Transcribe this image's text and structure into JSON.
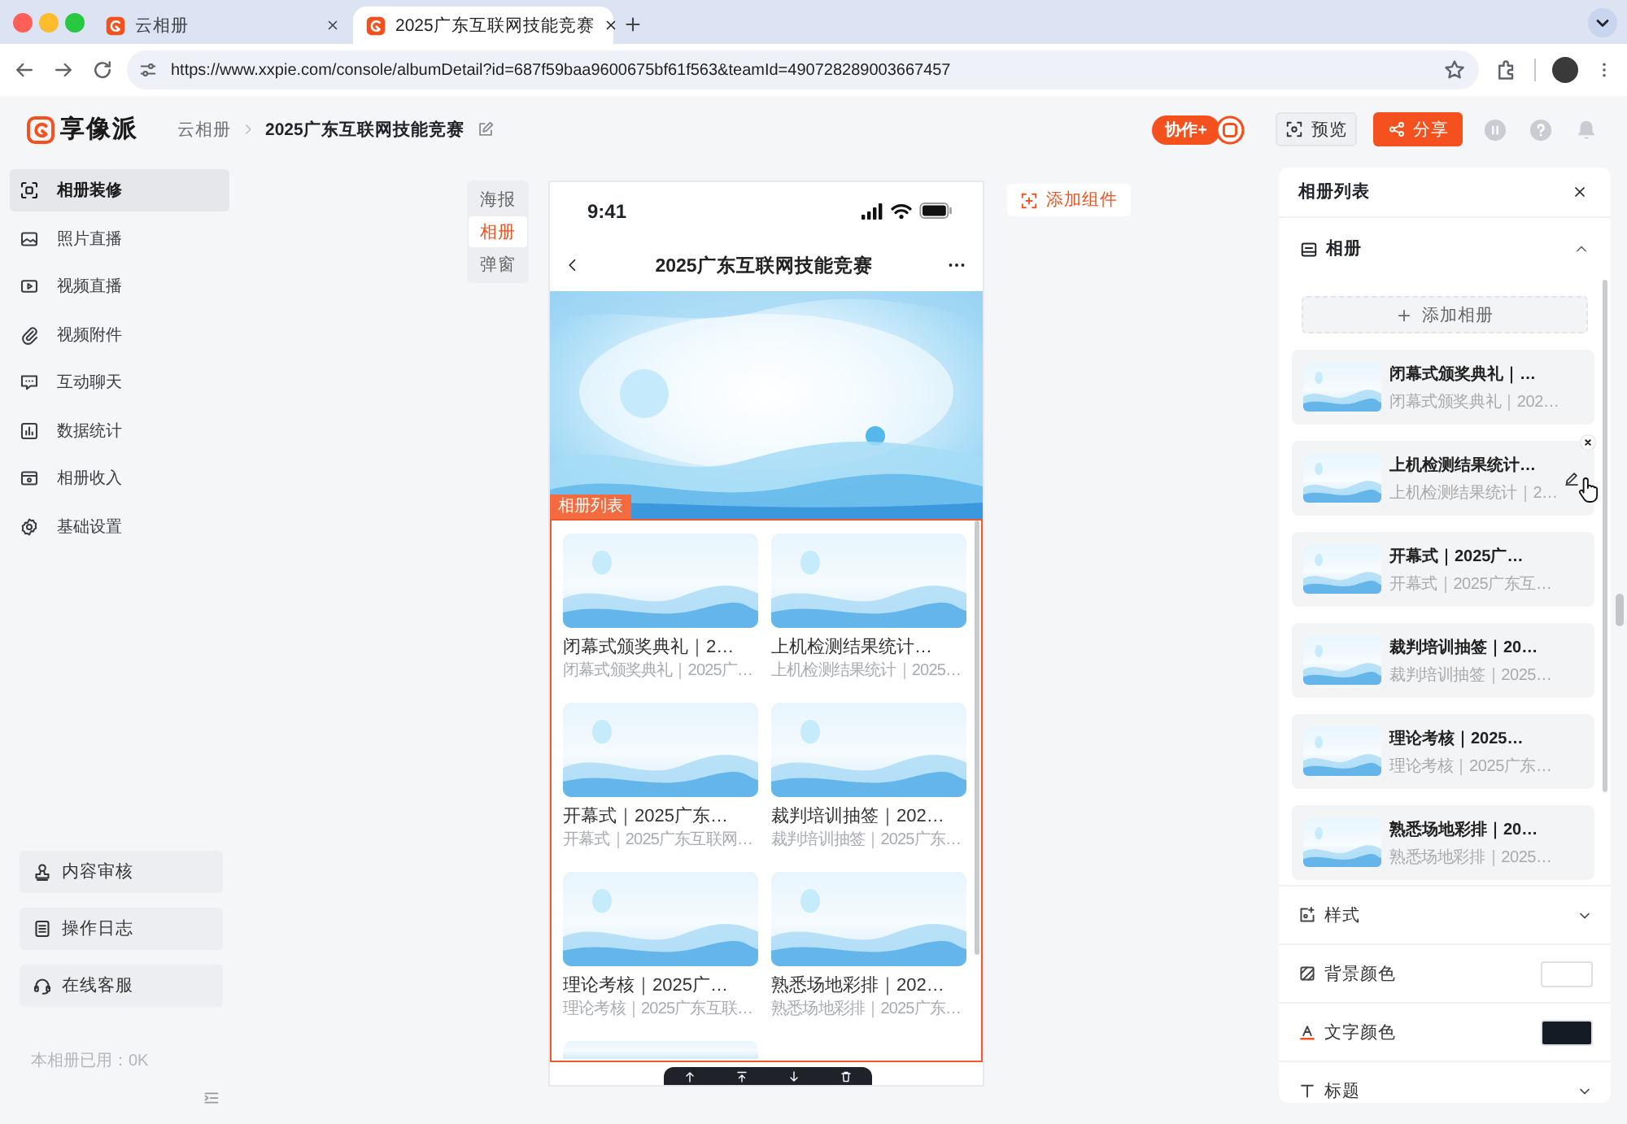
{
  "browser": {
    "tabs": [
      {
        "title": "云相册",
        "selected": false
      },
      {
        "title": "2025广东互联网技能竞赛",
        "selected": true
      }
    ],
    "url": "https://www.xxpie.com/console/albumDetail?id=687f59baa9600675bf61f563&teamId=490728289003667457"
  },
  "header": {
    "logo": "享像派",
    "breadcrumb": [
      "云相册",
      "2025广东互联网技能竞赛"
    ],
    "collab_button": "协作+",
    "preview_button": "预览",
    "share_button": "分享"
  },
  "sidebar": {
    "items": [
      {
        "label": "相册装修",
        "selected": true
      },
      {
        "label": "照片直播",
        "selected": false
      },
      {
        "label": "视频直播",
        "selected": false
      },
      {
        "label": "视频附件",
        "selected": false
      },
      {
        "label": "互动聊天",
        "selected": false
      },
      {
        "label": "数据统计",
        "selected": false
      },
      {
        "label": "相册收入",
        "selected": false
      },
      {
        "label": "基础设置",
        "selected": false
      }
    ],
    "bottom_buttons": [
      "内容审核",
      "操作日志",
      "在线客服"
    ],
    "usage": "本相册已用：0K"
  },
  "editor": {
    "side_tabs": [
      {
        "label": "海报",
        "selected": false
      },
      {
        "label": "相册",
        "selected": true
      },
      {
        "label": "弹窗",
        "selected": false
      }
    ],
    "add_component_button": "添加组件"
  },
  "phone": {
    "time": "9:41",
    "title": "2025广东互联网技能竞赛",
    "component_tag": "相册列表",
    "albums": [
      {
        "title": "闭幕式颁奖典礼｜2…",
        "subtitle": "闭幕式颁奖典礼｜2025广…"
      },
      {
        "title": "上机检测结果统计…",
        "subtitle": "上机检测结果统计｜2025…"
      },
      {
        "title": "开幕式｜2025广东…",
        "subtitle": "开幕式｜2025广东互联网…"
      },
      {
        "title": "裁判培训抽签｜202…",
        "subtitle": "裁判培训抽签｜2025广东…"
      },
      {
        "title": "理论考核｜2025广…",
        "subtitle": "理论考核｜2025广东互联…"
      },
      {
        "title": "熟悉场地彩排｜202…",
        "subtitle": "熟悉场地彩排｜2025广东…"
      }
    ],
    "next_cover_peeking": true
  },
  "panel": {
    "title": "相册列表",
    "section": {
      "label": "相册",
      "expanded": true
    },
    "add_button": "添加相册",
    "albums": [
      {
        "title": "闭幕式颁奖典礼｜…",
        "subtitle": "闭幕式颁奖典礼｜202…",
        "hovered": false
      },
      {
        "title": "上机检测结果统计…",
        "subtitle": "上机检测结果统计｜2…",
        "hovered": true
      },
      {
        "title": "开幕式｜2025广…",
        "subtitle": "开幕式｜2025广东互…",
        "hovered": false
      },
      {
        "title": "裁判培训抽签｜20…",
        "subtitle": "裁判培训抽签｜2025…",
        "hovered": false
      },
      {
        "title": "理论考核｜2025…",
        "subtitle": "理论考核｜2025广东…",
        "hovered": false
      },
      {
        "title": "熟悉场地彩排｜20…",
        "subtitle": "熟悉场地彩排｜2025…",
        "hovered": false
      }
    ],
    "settings": [
      {
        "kind": "group",
        "label": "样式",
        "expanded": false
      },
      {
        "kind": "color",
        "label": "背景颜色",
        "color": "#ffffff"
      },
      {
        "kind": "color",
        "label": "文字颜色",
        "color": "#151b24"
      },
      {
        "kind": "group",
        "label": "标题",
        "expanded": false
      }
    ]
  }
}
